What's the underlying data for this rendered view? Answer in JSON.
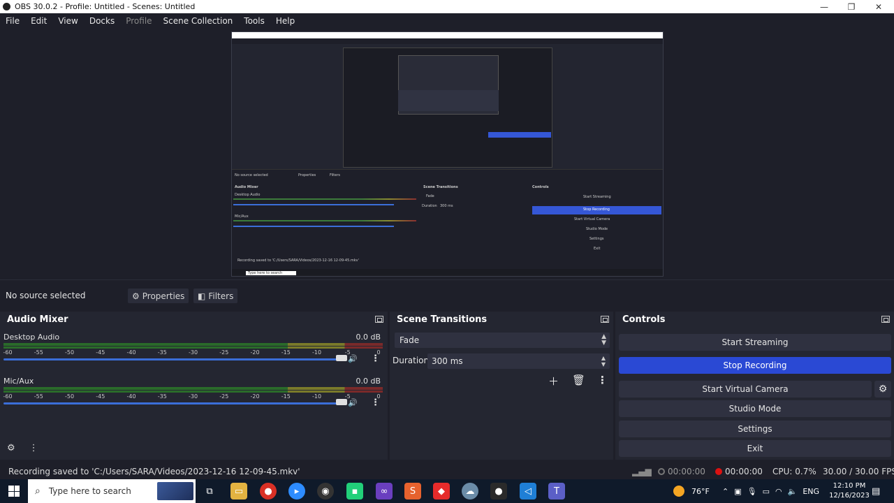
{
  "window": {
    "title": "OBS 30.0.2 - Profile: Untitled - Scenes: Untitled",
    "minimize": "—",
    "maximize": "❐",
    "close": "✕"
  },
  "menu": {
    "items": [
      "File",
      "Edit",
      "View",
      "Docks",
      "Profile",
      "Scene Collection",
      "Tools",
      "Help"
    ]
  },
  "preview": {
    "nested_no_source": "No source selected",
    "nested_properties": "Properties",
    "nested_filters": "Filters",
    "nested_audio_mixer": "Audio Mixer",
    "nested_scene_transitions": "Scene Transitions",
    "nested_controls": "Controls",
    "nested_desktop_audio": "Desktop Audio",
    "nested_mic": "Mic/Aux",
    "nested_fade": "Fade",
    "nested_duration": "Duration",
    "nested_duration_value": "300 ms",
    "nested_start_streaming": "Start Streaming",
    "nested_stop_recording": "Stop Recording",
    "nested_virtual_camera": "Start Virtual Camera",
    "nested_studio_mode": "Studio Mode",
    "nested_settings": "Settings",
    "nested_exit": "Exit",
    "nested_status": "Recording saved to 'C:/Users/SARA/Videos/2023-12-16 12-09-45.mkv'",
    "nested_search": "Type here to search"
  },
  "source_bar": {
    "no_source": "No source selected",
    "properties": "Properties",
    "filters": "Filters"
  },
  "audio_mixer": {
    "title": "Audio Mixer",
    "tracks": [
      {
        "name": "Desktop Audio",
        "db": "0.0 dB",
        "volume_fraction": 1.0
      },
      {
        "name": "Mic/Aux",
        "db": "0.0 dB",
        "volume_fraction": 1.0
      }
    ],
    "ticks": [
      "-60",
      "-55",
      "-50",
      "-45",
      "-40",
      "-35",
      "-30",
      "-25",
      "-20",
      "-15",
      "-10",
      "-5",
      "0"
    ]
  },
  "scene_transitions": {
    "title": "Scene Transitions",
    "transition": "Fade",
    "duration_label": "Duration",
    "duration_value": "300 ms"
  },
  "controls": {
    "title": "Controls",
    "start_streaming": "Start Streaming",
    "stop_recording": "Stop Recording",
    "start_virtual_camera": "Start Virtual Camera",
    "studio_mode": "Studio Mode",
    "settings": "Settings",
    "exit": "Exit"
  },
  "status": {
    "message": "Recording saved to 'C:/Users/SARA/Videos/2023-12-16 12-09-45.mkv'",
    "stream_time": "00:00:00",
    "record_time": "00:00:00",
    "cpu": "CPU: 0.7%",
    "fps": "30.00 / 30.00 FPS"
  },
  "taskbar": {
    "search_placeholder": "Type here to search",
    "weather": "76°F",
    "language": "ENG",
    "time": "12:10 PM",
    "date": "12/16/2023"
  },
  "colors": {
    "accent": "#2a49d4",
    "record_dot": "#dd1111",
    "background": "#1e1f29",
    "panel": "#242631"
  }
}
